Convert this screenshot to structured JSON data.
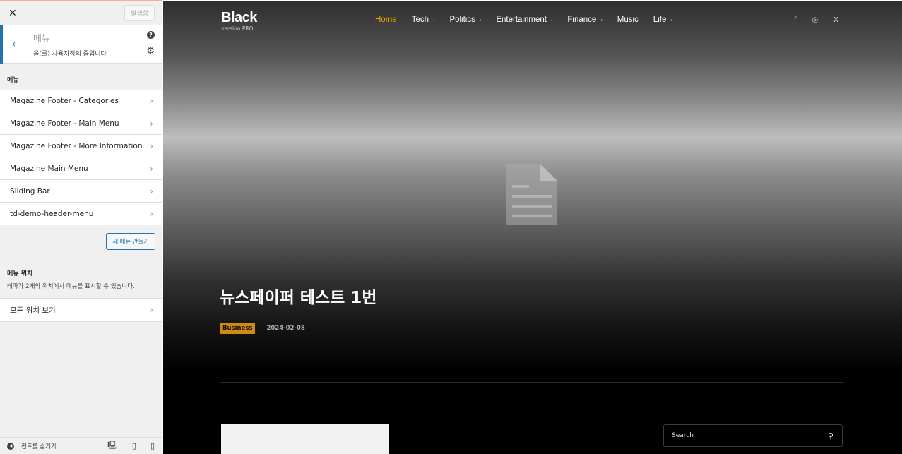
{
  "sidebar": {
    "close_icon": "close-icon",
    "publish_label": "발행함",
    "section_title": "메뉴",
    "section_subtitle": "을(를) 사용자정의 중입니다",
    "help_icon": "?",
    "gear_icon": "gear-icon",
    "menus_label": "메뉴",
    "menus": [
      {
        "label": "Magazine Footer - Categories"
      },
      {
        "label": "Magazine Footer - Main Menu"
      },
      {
        "label": "Magazine Footer - More Information"
      },
      {
        "label": "Magazine Main Menu"
      },
      {
        "label": "Sliding Bar"
      },
      {
        "label": "td-demo-header-menu"
      }
    ],
    "new_menu_button": "새 메뉴 만들기",
    "locations_title": "메뉴 위치",
    "locations_desc": "테마가 2개의 위치에서 메뉴를 표시할 수 있습니다.",
    "view_all_locations": "모든 위치 보기",
    "hide_controls": "컨트롤 숨기기"
  },
  "preview": {
    "logo_main": "Black",
    "logo_sub": "version PRO",
    "nav": [
      {
        "label": "Home",
        "active": true,
        "dropdown": false
      },
      {
        "label": "Tech",
        "active": false,
        "dropdown": true
      },
      {
        "label": "Politics",
        "active": false,
        "dropdown": true
      },
      {
        "label": "Entertainment",
        "active": false,
        "dropdown": true
      },
      {
        "label": "Finance",
        "active": false,
        "dropdown": true
      },
      {
        "label": "Music",
        "active": false,
        "dropdown": false
      },
      {
        "label": "Life",
        "active": false,
        "dropdown": true
      }
    ],
    "social": [
      "f",
      "◎",
      "X"
    ],
    "headline": "뉴스페이퍼 테스트 1번",
    "category": "Business",
    "date": "2024-02-08",
    "search_placeholder": "Search",
    "colors": {
      "accent": "#f2a200",
      "category_bg": "#d08a10",
      "sidebar_accent": "#2271b1"
    }
  }
}
